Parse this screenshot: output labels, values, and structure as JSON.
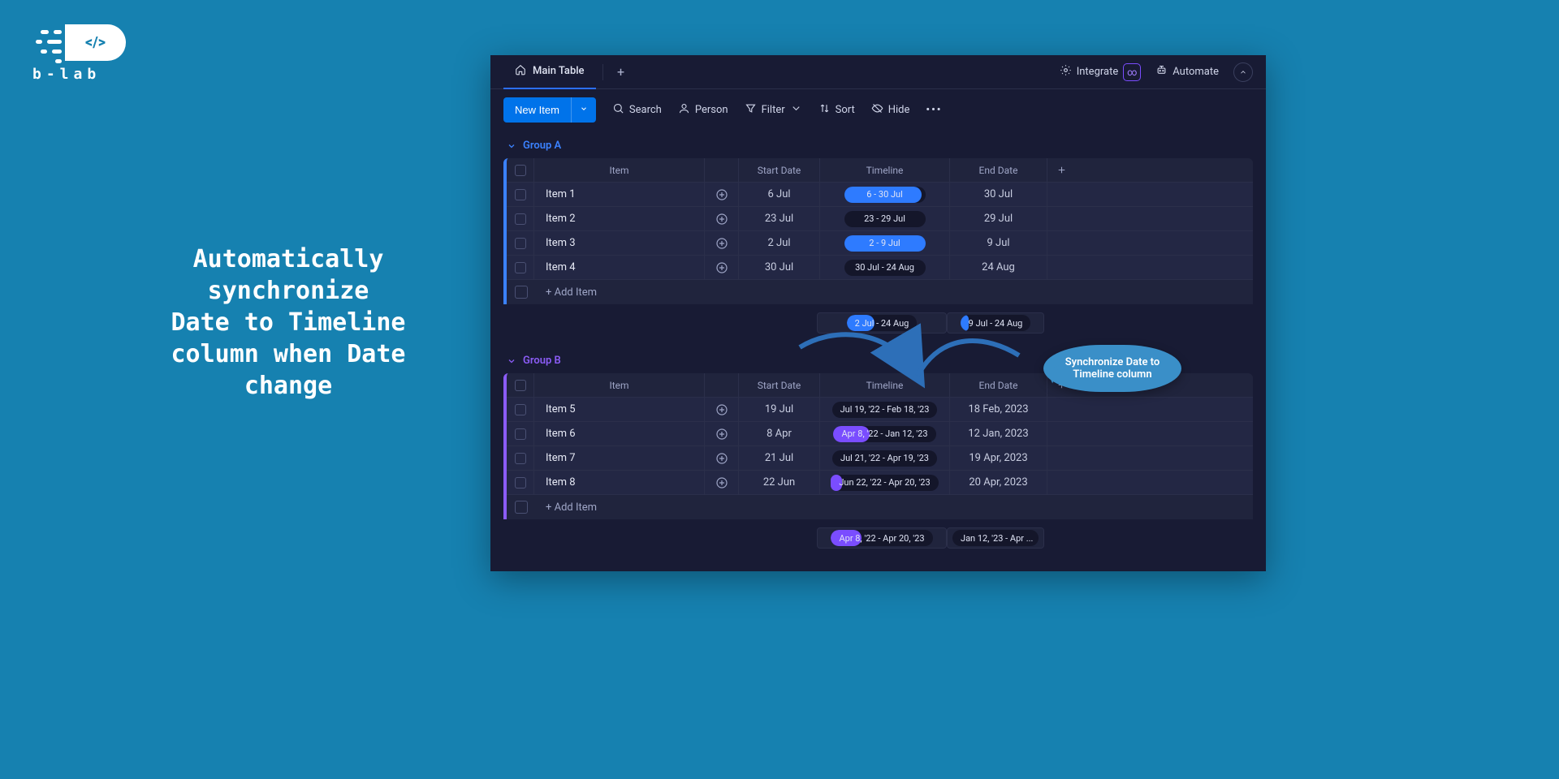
{
  "brand": {
    "name": "b-lab"
  },
  "headline": "Automatically synchronize\nDate to Timeline column when Date change",
  "callout": "Synchronize Date to Timeline column",
  "topbar": {
    "tab": "Main Table",
    "integrate": "Integrate",
    "automate": "Automate"
  },
  "toolbar": {
    "newItem": "New Item",
    "search": "Search",
    "person": "Person",
    "filter": "Filter",
    "sort": "Sort",
    "hide": "Hide"
  },
  "columns": {
    "item": "Item",
    "startDate": "Start Date",
    "timeline": "Timeline",
    "endDate": "End Date"
  },
  "addItem": "+ Add Item",
  "groups": [
    {
      "id": "a",
      "name": "Group A",
      "color": "blue",
      "rows": [
        {
          "item": "Item 1",
          "start": "6 Jul",
          "timeline": "6 - 30 Jul",
          "end": "30 Jul",
          "pillColor": "blue",
          "pillWidth": 95
        },
        {
          "item": "Item 2",
          "start": "23 Jul",
          "timeline": "23 - 29 Jul",
          "end": "29 Jul",
          "pillColor": "none",
          "pillWidth": 0
        },
        {
          "item": "Item 3",
          "start": "2 Jul",
          "timeline": "2 - 9 Jul",
          "end": "9 Jul",
          "pillColor": "blue",
          "pillWidth": 100
        },
        {
          "item": "Item 4",
          "start": "30 Jul",
          "timeline": "30 Jul - 24 Aug",
          "end": "24 Aug",
          "pillColor": "none",
          "pillWidth": 0
        }
      ],
      "summary": {
        "timeline": {
          "text": "2 Jul - 24 Aug",
          "color": "blue",
          "width": 40
        },
        "endDate": {
          "text": "9 Jul - 24 Aug",
          "color": "blue",
          "width": 12
        }
      }
    },
    {
      "id": "b",
      "name": "Group B",
      "color": "purple",
      "rows": [
        {
          "item": "Item 5",
          "start": "19 Jul",
          "timeline": "Jul 19, '22 - Feb 18, '23",
          "end": "18 Feb, 2023",
          "pillColor": "none",
          "pillWidth": 5
        },
        {
          "item": "Item 6",
          "start": "8 Apr",
          "timeline": "Apr 8, '22 - Jan 12, '23",
          "end": "12 Jan, 2023",
          "pillColor": "purple",
          "pillWidth": 35
        },
        {
          "item": "Item 7",
          "start": "21 Jul",
          "timeline": "Jul 21, '22 - Apr 19, '23",
          "end": "19 Apr, 2023",
          "pillColor": "none",
          "pillWidth": 0
        },
        {
          "item": "Item 8",
          "start": "22 Jun",
          "timeline": "Jun 22, '22 - Apr 20, '23",
          "end": "20 Apr, 2023",
          "pillColor": "purple",
          "pillWidth": 10
        }
      ],
      "summary": {
        "timeline": {
          "text": "Apr 8, '22 - Apr 20, '23",
          "color": "purple",
          "width": 30
        },
        "endDate": {
          "text": "Jan 12, '23 - Apr ...",
          "color": "none",
          "width": 0
        }
      }
    }
  ]
}
